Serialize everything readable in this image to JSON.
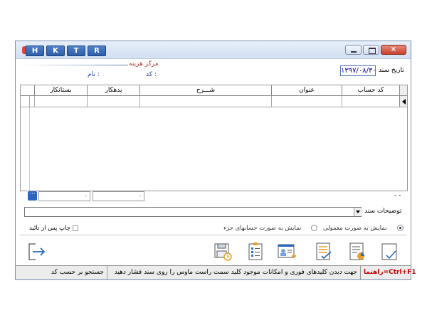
{
  "window": {
    "hktr_buttons": [
      "H",
      "K",
      "T",
      "R"
    ],
    "close_glyph": "×"
  },
  "header": {
    "cost_center_label": "مرکز هزینه",
    "code_label": "کد :",
    "name_label": "نام :",
    "doc_date_label": "تاریخ سند",
    "doc_date_value": "۱۳۹۷/۰۸/۳۰"
  },
  "grid": {
    "columns": [
      "کد حساب",
      "عنوان",
      "شـــرح",
      "بدهکار",
      "بستانکار"
    ]
  },
  "totals": {
    "dash_text": "- -",
    "debit_value": "۰",
    "credit_value": "۰",
    "more_glyph": "···"
  },
  "description": {
    "label": "توضیحات سند",
    "value": ""
  },
  "options": {
    "radio_normal": "نمایش به صورت معمولی",
    "radio_detail": "نمایش به صورت حسابهای جزء",
    "print_after_confirm": "چاپ پس از تائید"
  },
  "toolbar": {
    "icons": [
      "new-document-icon",
      "report-chart-icon",
      "confirm-list-icon",
      "add-user-icon",
      "checklist-icon",
      "save-history-icon",
      "exit-icon"
    ]
  },
  "status": {
    "help_label": "راهنما=Ctrl+F1",
    "help_text": "جهت دیدن کلیدهای فوری و امکانات موجود کلید سمت راست ماوس را روی سند فشار دهید",
    "search_text": "جستجو بر حسب کد"
  },
  "colors": {
    "accent": "#2d5ea8",
    "label_red": "#b03030",
    "label_blue": "#1a3a9a",
    "help_red": "#c00000"
  }
}
